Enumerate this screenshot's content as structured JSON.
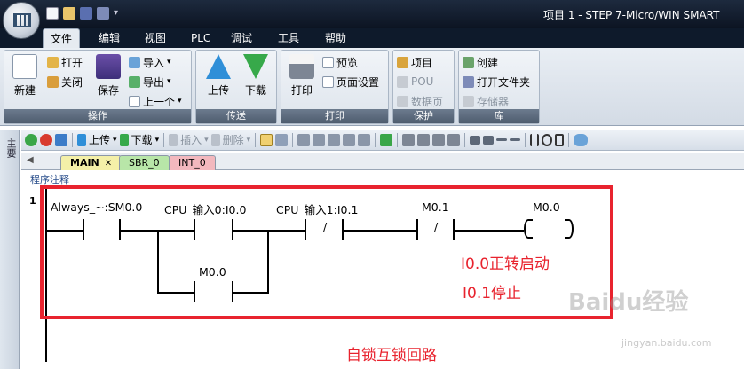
{
  "window": {
    "title": "项目 1 - STEP 7-Micro/WIN SMART"
  },
  "colors": {
    "title_bg": "#0e1a2b",
    "accent_red": "#e8232e",
    "rail": "#000000"
  },
  "ribbon_tabs": [
    "文件",
    "编辑",
    "视图",
    "PLC",
    "调试",
    "工具",
    "帮助"
  ],
  "ribbon": {
    "groups": [
      {
        "label": "操作",
        "big": [
          "新建",
          "保存"
        ],
        "small": [
          "打开",
          "关闭",
          "导入",
          "导出",
          "上一个"
        ]
      },
      {
        "label": "传送",
        "big": [
          "上传",
          "下载"
        ]
      },
      {
        "label": "打印",
        "big": [
          "打印"
        ],
        "small": [
          "预览",
          "页面设置"
        ]
      },
      {
        "label": "保护",
        "small": [
          "项目",
          "POU",
          "数据页"
        ]
      },
      {
        "label": "库",
        "small": [
          "创建",
          "打开文件夹",
          "存储器"
        ]
      }
    ]
  },
  "toolbar": {
    "upload": "上传",
    "download": "下载",
    "insert": "插入",
    "delete": "删除"
  },
  "side_panel": {
    "label": "主要"
  },
  "program_tabs": [
    "MAIN",
    "SBR_0",
    "INT_0"
  ],
  "editor": {
    "comment_label": "程序注释",
    "network_number": "1",
    "labels": {
      "c1": "Always_~:SM0.0",
      "c2": "CPU_输入0:I0.0",
      "c3": "CPU_输入1:I0.1",
      "c4": "M0.1",
      "coil": "M0.0",
      "parallel": "M0.0",
      "nc_mark": "/"
    }
  },
  "annotations": {
    "note1": "I0.0正转启动",
    "note2": "I0.1停止",
    "note3": "自锁互锁回路"
  },
  "watermark": {
    "main": "Baidu经验",
    "sub": "jingyan.baidu.com"
  }
}
